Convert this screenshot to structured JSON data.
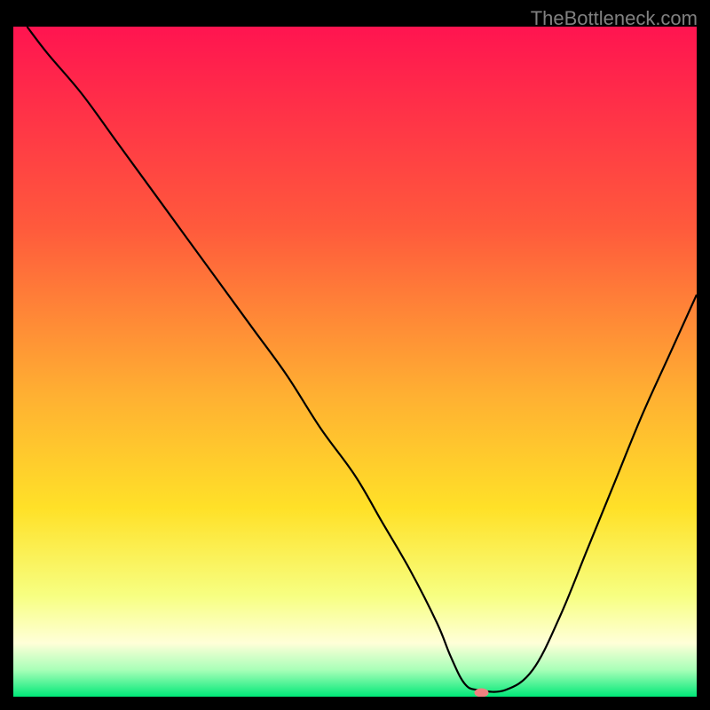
{
  "watermark": "TheBottleneck.com",
  "chart_data": {
    "type": "line",
    "title": "",
    "xlabel": "",
    "ylabel": "",
    "xlim": [
      0,
      100
    ],
    "ylim": [
      0,
      100
    ],
    "gradient_stops": [
      {
        "offset": 0,
        "color": "#ff1450"
      },
      {
        "offset": 30,
        "color": "#ff5a3c"
      },
      {
        "offset": 55,
        "color": "#ffb032"
      },
      {
        "offset": 72,
        "color": "#ffe128"
      },
      {
        "offset": 85,
        "color": "#f7ff82"
      },
      {
        "offset": 92,
        "color": "#ffffd8"
      },
      {
        "offset": 96,
        "color": "#a8ffb8"
      },
      {
        "offset": 100,
        "color": "#00e878"
      }
    ],
    "series": [
      {
        "name": "bottleneck-curve",
        "color": "#000000",
        "x": [
          2,
          5,
          10,
          15,
          20,
          25,
          30,
          35,
          40,
          45,
          50,
          54,
          58,
          62,
          64,
          66,
          68,
          72,
          76,
          80,
          84,
          88,
          92,
          96,
          100
        ],
        "y": [
          100,
          96,
          90,
          83,
          76,
          69,
          62,
          55,
          48,
          40,
          33,
          26,
          19,
          11,
          6,
          2,
          1,
          1,
          4,
          12,
          22,
          32,
          42,
          51,
          60
        ]
      }
    ],
    "marker": {
      "name": "optimal-point",
      "x": 68.5,
      "y": 0.6,
      "color": "#f08080",
      "rx": 8,
      "ry": 5
    }
  }
}
